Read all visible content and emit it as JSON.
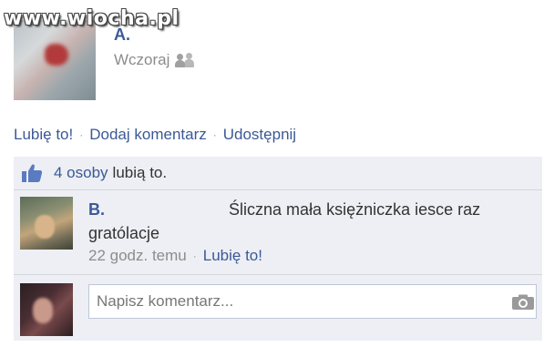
{
  "watermark": "www.wiocha.pl",
  "post": {
    "author": "A.",
    "timestamp": "Wczoraj",
    "audience_icon": "friends-icon"
  },
  "actions": {
    "like": "Lubię to!",
    "separator": "·",
    "comment": "Dodaj komentarz",
    "share": "Udostępnij"
  },
  "likes": {
    "icon": "thumbs-up-icon",
    "count": "4 osoby",
    "text": "lubią to."
  },
  "comment": {
    "author": "B.",
    "text": "Śliczna mała księżniczka iesce raz gratólacje",
    "time": "22 godz. temu",
    "like": "Lubię to!"
  },
  "write_comment": {
    "placeholder": "Napisz komentarz...",
    "camera_icon": "camera-icon"
  },
  "colors": {
    "link": "#3b5998",
    "meta": "#8c8c8c",
    "panel": "#edeff4",
    "border": "#d3d6db"
  }
}
